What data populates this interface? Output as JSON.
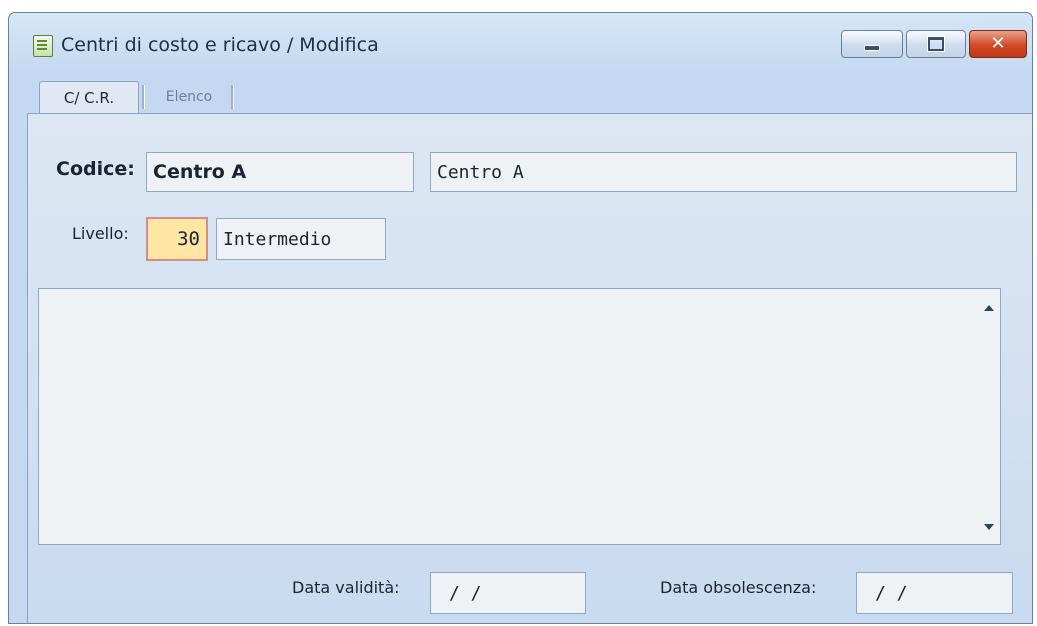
{
  "window": {
    "title": "Centri di costo e ricavo / Modifica",
    "icon": "document-icon",
    "controls": {
      "minimize": "minimize",
      "maximize": "maximize",
      "close": "close"
    }
  },
  "tabs": [
    {
      "label": "C/ C.R.",
      "active": true
    },
    {
      "label": "Elenco",
      "active": false
    }
  ],
  "form": {
    "codice_label": "Codice:",
    "codice_value": "Centro A",
    "descrizione_value": "Centro A",
    "livello_label": "Livello:",
    "livello_value": "30",
    "livello_desc": "Intermedio",
    "note_value": "",
    "data_validita_label": "Data validità:",
    "data_validita_value": "/ /",
    "data_obsolescenza_label": "Data obsolescenza:",
    "data_obsolescenza_value": "/ /"
  },
  "colors": {
    "titlebar": "#c4d9f1",
    "close_button": "#d14a25",
    "required_field": "#ffe6a3"
  }
}
